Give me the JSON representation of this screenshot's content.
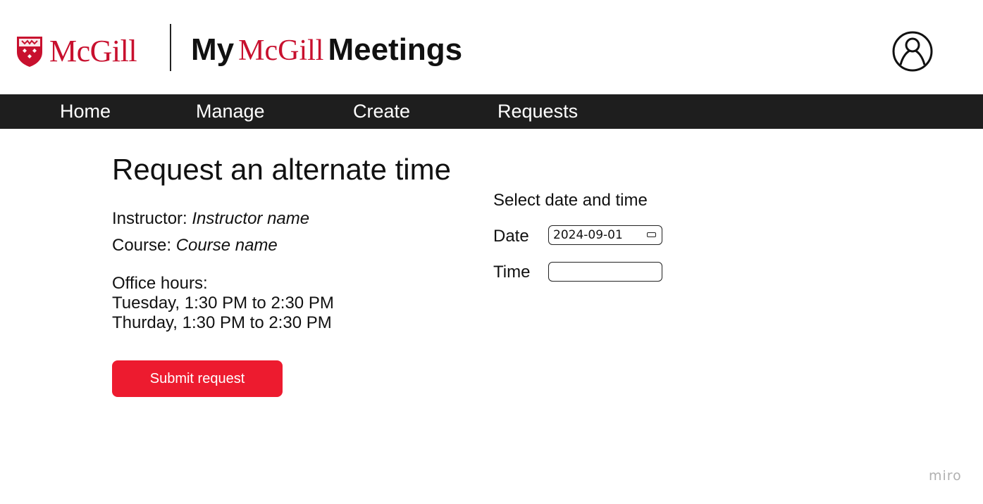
{
  "header": {
    "logo_text": "McGill",
    "brand_my": "My",
    "brand_mcgill": "McGill",
    "brand_meetings": "Meetings"
  },
  "nav": {
    "items": [
      {
        "label": "Home"
      },
      {
        "label": "Manage"
      },
      {
        "label": "Create"
      },
      {
        "label": "Requests"
      }
    ]
  },
  "main": {
    "title": "Request an alternate time",
    "instructor_label": "Instructor: ",
    "instructor_value": "Instructor name",
    "course_label": "Course: ",
    "course_value": "Course name",
    "office_hours_label": "Office hours:",
    "office_hours": [
      "Tuesday, 1:30 PM to 2:30 PM",
      "Thurday, 1:30 PM to 2:30 PM"
    ],
    "submit_label": "Submit request"
  },
  "form": {
    "heading": "Select date and time",
    "date_label": "Date",
    "date_value": "2024-09-01",
    "time_label": "Time",
    "time_value": ""
  },
  "watermark": "miro",
  "colors": {
    "brand_red": "#c8102e",
    "button_red": "#ed1b2f",
    "nav_bg": "#1e1e1e"
  },
  "icons": {
    "profile": "user-circle-icon",
    "calendar": "calendar-icon",
    "shield": "mcgill-shield-icon"
  }
}
